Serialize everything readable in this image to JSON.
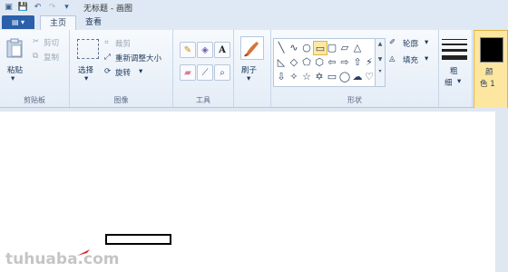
{
  "window": {
    "title": "无标题 - 画图"
  },
  "tabs": [
    {
      "label": "主页"
    },
    {
      "label": "查看"
    }
  ],
  "file_menu": {
    "icon": "file-menu-icon"
  },
  "clipboard": {
    "paste": "粘贴",
    "cut": "剪切",
    "copy": "复制",
    "group": "剪贴板"
  },
  "image": {
    "select": "选择",
    "crop": "裁剪",
    "resize": "重新调整大小",
    "rotate": "旋转",
    "group": "图像"
  },
  "tools": {
    "group": "工具"
  },
  "brushes": {
    "label": "刷子"
  },
  "shapes": {
    "outline": "轮廓",
    "fill": "填充",
    "group": "形状",
    "glyphs": [
      "╲",
      "∿",
      "○",
      "▭",
      "▢",
      "▱",
      "△",
      "◺",
      "◇",
      "⬠",
      "⬡",
      "⇦",
      "⇨",
      "⇧",
      "⇩",
      "✧",
      "☆",
      "✡",
      "▭",
      "◯",
      "☁",
      "♡",
      "⚡"
    ]
  },
  "size": {
    "label1": "粗",
    "label2": "细"
  },
  "color1": {
    "label1": "颜",
    "label2": "色 1",
    "swatch": "#000000"
  },
  "watermark": {
    "text": "tuhuaba.com"
  }
}
